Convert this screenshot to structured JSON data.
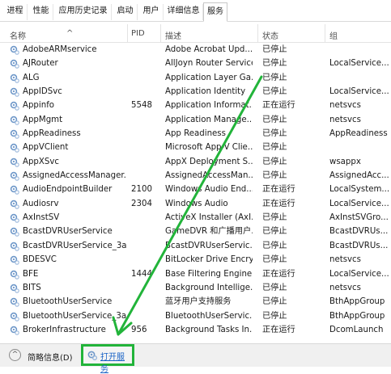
{
  "tabs": [
    "进程",
    "性能",
    "应用历史记录",
    "启动",
    "用户",
    "详细信息",
    "服务"
  ],
  "active_tab": "服务",
  "columns": {
    "name": "名称",
    "pid": "PID",
    "desc": "描述",
    "state": "状态",
    "group": "组"
  },
  "rows": [
    {
      "name": "AdobeARMservice",
      "pid": "",
      "desc": "Adobe Acrobat Upd...",
      "state": "已停止",
      "group": ""
    },
    {
      "name": "AJRouter",
      "pid": "",
      "desc": "AllJoyn Router Service",
      "state": "已停止",
      "group": "LocalService..."
    },
    {
      "name": "ALG",
      "pid": "",
      "desc": "Application Layer Ga...",
      "state": "已停止",
      "group": ""
    },
    {
      "name": "AppIDSvc",
      "pid": "",
      "desc": "Application Identity",
      "state": "已停止",
      "group": "LocalService..."
    },
    {
      "name": "Appinfo",
      "pid": "5548",
      "desc": "Application Informat...",
      "state": "正在运行",
      "group": "netsvcs"
    },
    {
      "name": "AppMgmt",
      "pid": "",
      "desc": "Application Manage...",
      "state": "已停止",
      "group": "netsvcs"
    },
    {
      "name": "AppReadiness",
      "pid": "",
      "desc": "App Readiness",
      "state": "已停止",
      "group": "AppReadiness"
    },
    {
      "name": "AppVClient",
      "pid": "",
      "desc": "Microsoft App-V Clie...",
      "state": "已停止",
      "group": ""
    },
    {
      "name": "AppXSvc",
      "pid": "",
      "desc": "AppX Deployment S...",
      "state": "已停止",
      "group": "wsappx"
    },
    {
      "name": "AssignedAccessManager...",
      "pid": "",
      "desc": "AssignedAccessMan...",
      "state": "已停止",
      "group": "AssignedAcc..."
    },
    {
      "name": "AudioEndpointBuilder",
      "pid": "2100",
      "desc": "Windows Audio End...",
      "state": "正在运行",
      "group": "LocalSystem..."
    },
    {
      "name": "Audiosrv",
      "pid": "2304",
      "desc": "Windows Audio",
      "state": "正在运行",
      "group": "LocalService..."
    },
    {
      "name": "AxInstSV",
      "pid": "",
      "desc": "ActiveX Installer (AxI...",
      "state": "已停止",
      "group": "AxInstSVGro..."
    },
    {
      "name": "BcastDVRUserService",
      "pid": "",
      "desc": "GameDVR 和广播用户...",
      "state": "已停止",
      "group": "BcastDVRUs..."
    },
    {
      "name": "BcastDVRUserService_3a...",
      "pid": "",
      "desc": "BcastDVRUserServic...",
      "state": "已停止",
      "group": "BcastDVRUs..."
    },
    {
      "name": "BDESVC",
      "pid": "",
      "desc": "BitLocker Drive Encry...",
      "state": "已停止",
      "group": "netsvcs"
    },
    {
      "name": "BFE",
      "pid": "1444",
      "desc": "Base Filtering Engine",
      "state": "正在运行",
      "group": "LocalService..."
    },
    {
      "name": "BITS",
      "pid": "",
      "desc": "Background Intellige...",
      "state": "已停止",
      "group": "netsvcs"
    },
    {
      "name": "BluetoothUserService",
      "pid": "",
      "desc": "蓝牙用户支持服务",
      "state": "已停止",
      "group": "BthAppGroup"
    },
    {
      "name": "BluetoothUserService_3a...",
      "pid": "",
      "desc": "BluetoothUserServic...",
      "state": "已停止",
      "group": "BthAppGroup"
    },
    {
      "name": "BrokerInfrastructure",
      "pid": "956",
      "desc": "Background Tasks In...",
      "state": "正在运行",
      "group": "DcomLaunch"
    }
  ],
  "footer": {
    "brief": "简略信息(D)",
    "open_services": "打开服务"
  },
  "colors": {
    "annotation_green": "#22b43a",
    "link_blue": "#1a63c6",
    "gear_blue": "#6f98c9"
  },
  "icons": {
    "row_icon": "service-gear-icon",
    "footer_icon": "services-icon",
    "collapse_icon": "chevron-up-icon"
  }
}
